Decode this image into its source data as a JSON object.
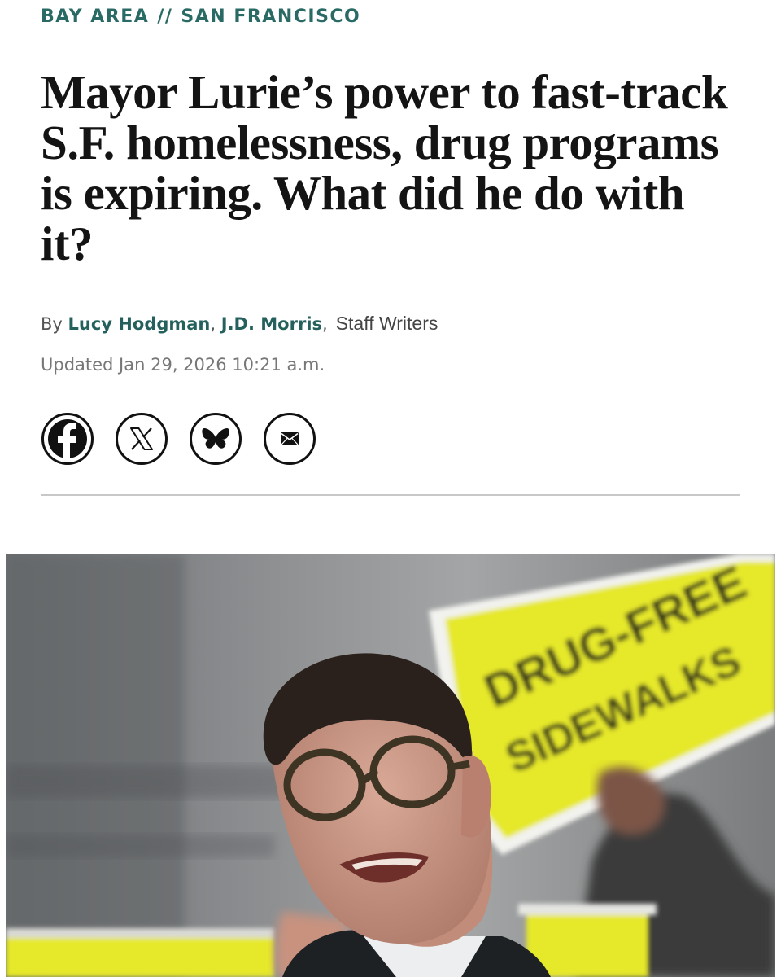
{
  "section_nav": {
    "primary": "BAY AREA",
    "separator": "//",
    "secondary": "SAN FRANCISCO"
  },
  "headline": "Mayor Lurie’s power to fast-track S.F. homelessness, drug programs is expiring. What did he do with it?",
  "byline": {
    "prefix": "By",
    "authors": [
      "Lucy Hodgman",
      "J.D. Morris"
    ],
    "author_separator": ",",
    "role_separator": ",",
    "roles": "Staff Writers"
  },
  "timestamp": "Updated Jan 29, 2026 10:21 a.m.",
  "share_buttons": [
    {
      "icon": "facebook-icon"
    },
    {
      "icon": "x-icon"
    },
    {
      "icon": "bluesky-icon"
    },
    {
      "icon": "email-icon"
    }
  ],
  "hero_image": {
    "sign_text": "DRUG-FREE SIDEWALKS",
    "colors": {
      "sign_yellow": "#e6e82a",
      "background_gray": "#8e9092"
    }
  },
  "colors": {
    "accent": "#2a6a64",
    "headline": "#141414",
    "meta": "#777777",
    "divider": "#c8c8c8"
  }
}
